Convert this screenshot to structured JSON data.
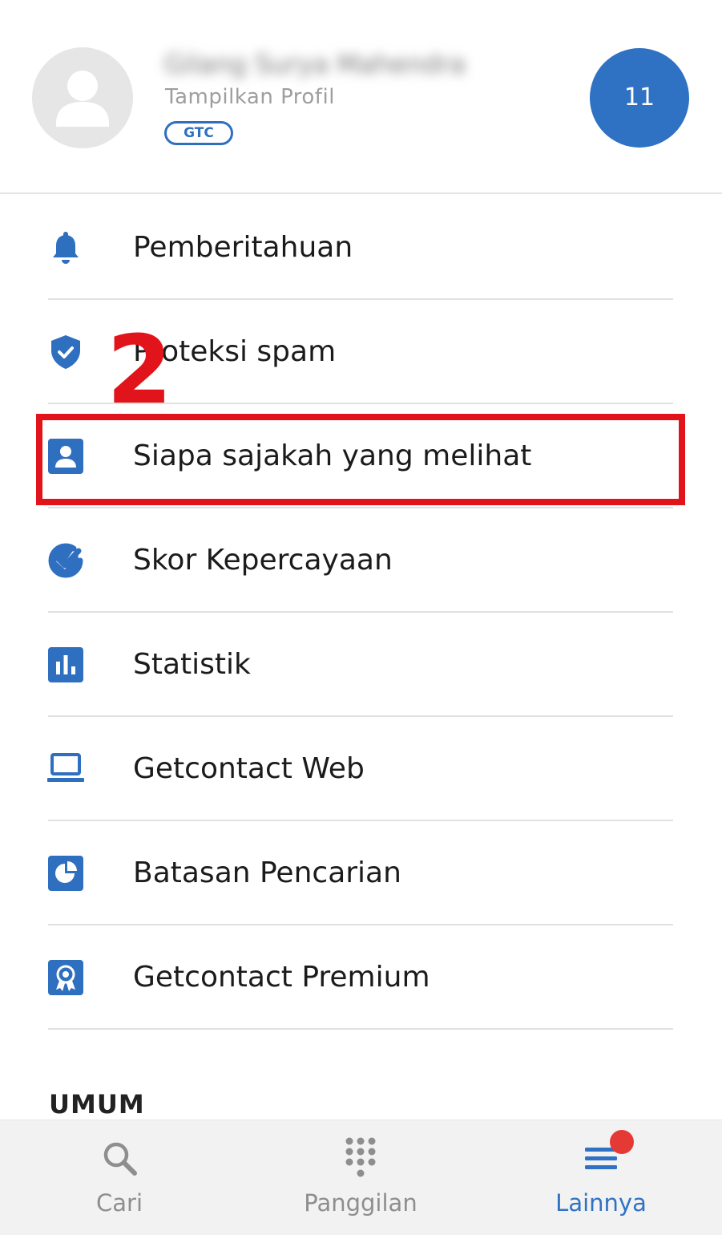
{
  "profile": {
    "name": "Gilang Surya Mahendra",
    "subtitle": "Tampilkan Profil",
    "badge": "GTC",
    "counter": "11"
  },
  "menu": {
    "items": [
      {
        "label": "Pemberitahuan",
        "icon": "bell-icon"
      },
      {
        "label": "Proteksi spam",
        "icon": "shield-icon"
      },
      {
        "label": "Siapa sajakah yang melihat",
        "icon": "contact-card-icon"
      },
      {
        "label": "Skor Kepercayaan",
        "icon": "check-badge-icon"
      },
      {
        "label": "Statistik",
        "icon": "bar-chart-icon"
      },
      {
        "label": "Getcontact Web",
        "icon": "laptop-icon"
      },
      {
        "label": "Batasan Pencarian",
        "icon": "pie-chart-icon"
      },
      {
        "label": "Getcontact Premium",
        "icon": "award-icon"
      }
    ]
  },
  "section": {
    "title": "UMUM"
  },
  "annotation": {
    "step": "2",
    "color": "#e2141b"
  },
  "nav": {
    "tabs": [
      {
        "label": "Cari",
        "icon": "search-icon"
      },
      {
        "label": "Panggilan",
        "icon": "dialpad-icon"
      },
      {
        "label": "Lainnya",
        "icon": "menu-icon"
      }
    ],
    "active": "Lainnya"
  },
  "colors": {
    "accent": "#2f72c4",
    "icon": "#2f6fc0",
    "notification": "#e53935"
  }
}
